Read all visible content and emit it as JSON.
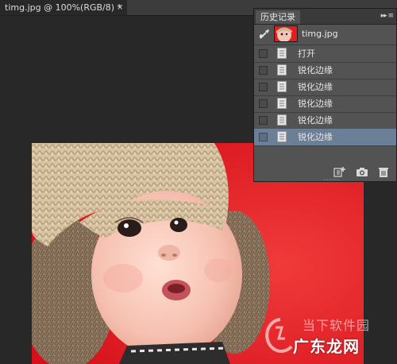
{
  "document": {
    "tab_title": "timg.jpg @ 100%(RGB/8) *",
    "close_glyph": "×"
  },
  "history_panel": {
    "tab_label": "历史记录",
    "menu_glyph": "▸▸ ≡",
    "snapshot": {
      "label": "timg.jpg",
      "icon": "history-brush-icon"
    },
    "rows": [
      {
        "label": "打开",
        "selected": false
      },
      {
        "label": "锐化边缘",
        "selected": false
      },
      {
        "label": "锐化边缘",
        "selected": false
      },
      {
        "label": "锐化边缘",
        "selected": false
      },
      {
        "label": "锐化边缘",
        "selected": false
      },
      {
        "label": "锐化边缘",
        "selected": true
      }
    ],
    "footer_icons": [
      "new-document-from-state-icon",
      "camera-icon",
      "trash-icon"
    ]
  },
  "watermark": {
    "line1": "当下软件园",
    "line2": "广东龙网"
  },
  "colors": {
    "selected_row": "#6b7f97",
    "panel_bg": "#535353",
    "canvas_bg": "#282828",
    "photo_bg": "#e0171e"
  }
}
